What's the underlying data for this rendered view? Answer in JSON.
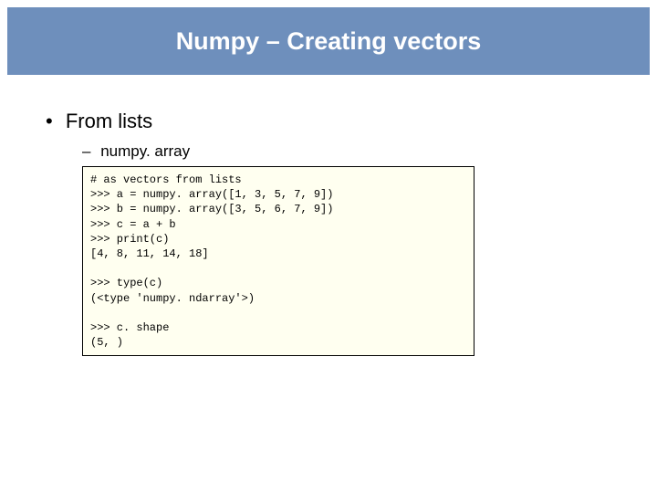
{
  "title": "Numpy – Creating vectors",
  "bullet_main": "From lists",
  "bullet_sub": "numpy. array",
  "code_text": "# as vectors from lists\n>>> a = numpy. array([1, 3, 5, 7, 9])\n>>> b = numpy. array([3, 5, 6, 7, 9])\n>>> c = a + b\n>>> print(c)\n[4, 8, 11, 14, 18]\n\n>>> type(c)\n(<type 'numpy. ndarray'>)\n\n>>> c. shape\n(5, )"
}
